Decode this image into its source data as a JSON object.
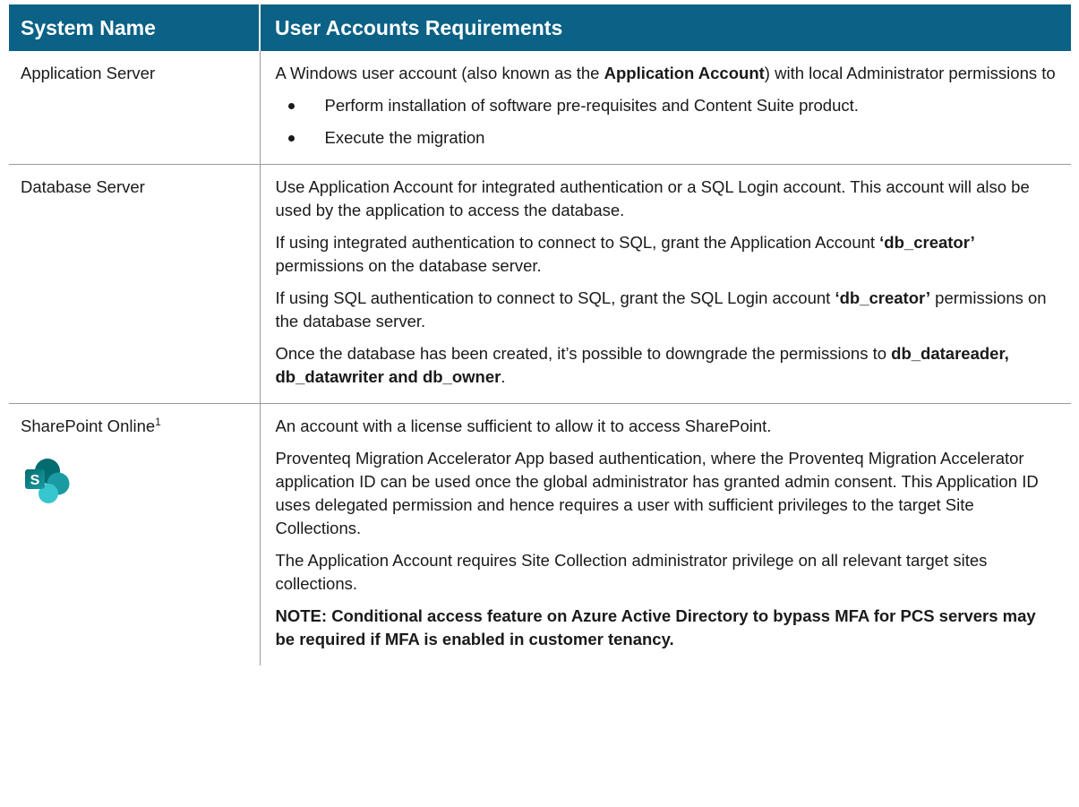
{
  "table": {
    "headers": {
      "system_name": "System Name",
      "requirements": "User Accounts Requirements"
    },
    "rows": [
      {
        "system": "Application Server",
        "intro": {
          "pre": "A Windows user account (also known as the ",
          "bold": "Application Account",
          "post": ") with local Administrator permissions to"
        },
        "bullets": [
          "Perform installation of software pre-requisites and Content Suite product.",
          "Execute the migration"
        ]
      },
      {
        "system": "Database Server",
        "p1": "Use Application Account for integrated authentication or a SQL Login account. This account will also be used by the application to access the database.",
        "p2": {
          "pre": "If using integrated authentication to connect to SQL, grant the Application Account ",
          "bold": "‘db_creator’",
          "post": " permissions on the database server."
        },
        "p3": {
          "pre": "If using SQL authentication to connect to SQL, grant the SQL Login account ",
          "bold": "‘db_creator’",
          "post": " permissions on the database server."
        },
        "p4": {
          "pre": "Once the database has been created, it’s possible to downgrade the permissions to ",
          "bold": "db_datareader, db_datawriter and db_owner",
          "post": "."
        }
      },
      {
        "system": "SharePoint Online",
        "footnote": "1",
        "icon": "sharepoint-logo-icon",
        "icon_letter": "S",
        "p1": "An account with a license sufficient to allow it to access SharePoint.",
        "p2": "Proventeq Migration Accelerator App based authentication, where the Proventeq Migration Accelerator application ID can be used once the global administrator has granted admin consent. This Application ID uses delegated permission and hence requires a user with sufficient privileges to the target Site Collections.",
        "p3": "The Application Account requires Site Collection administrator privilege on all relevant target sites collections.",
        "note": "NOTE: Conditional access feature on Azure Active Directory to bypass MFA for PCS servers may be required if MFA is enabled in customer tenancy."
      }
    ]
  },
  "colors": {
    "header_bg": "#0b6186",
    "header_text": "#ffffff",
    "rule": "#9a9a9a"
  }
}
